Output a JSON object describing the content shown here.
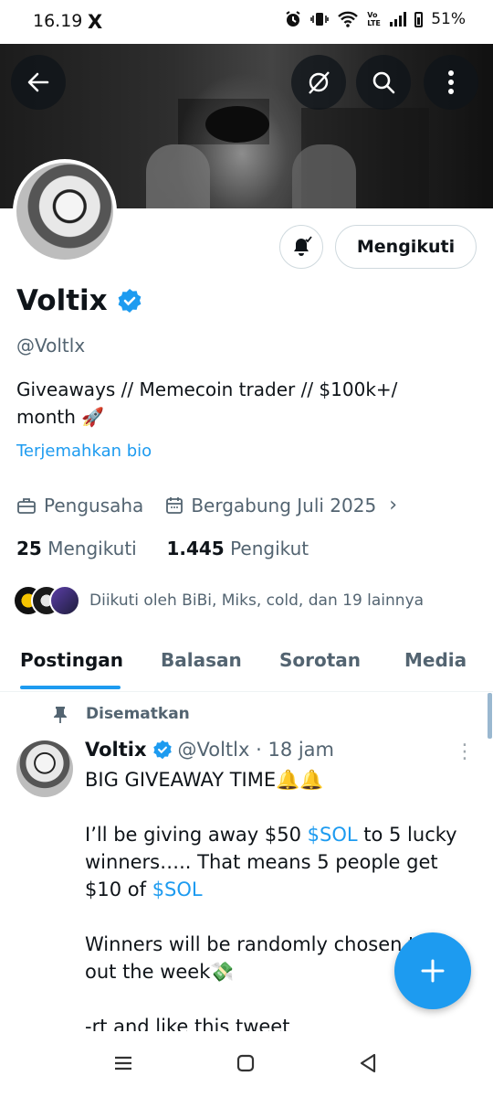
{
  "status": {
    "time": "16.19",
    "x_logo": "X",
    "volte": "Vo LTE",
    "battery": "51%"
  },
  "profile": {
    "name": "Voltix",
    "handle": "@Voltlx",
    "bio_line1": "Giveaways // Memecoin trader // $100k+/",
    "bio_line2": "month 🚀",
    "translate_label": "Terjemahkan bio",
    "category": "Pengusaha",
    "joined": "Bergabung Juli 2025",
    "following_count": "25",
    "following_label": "Mengikuti",
    "followers_count": "1.445",
    "followers_label": "Pengikut",
    "followed_by": "Diikuti oleh BiBi, Miks, cold, dan 19 lainnya",
    "follow_button": "Mengikuti"
  },
  "tabs": [
    {
      "label": "Postingan",
      "active": true
    },
    {
      "label": "Balasan",
      "active": false
    },
    {
      "label": "Sorotan",
      "active": false
    },
    {
      "label": "Media",
      "active": false
    }
  ],
  "post": {
    "pinned_label": "Disematkan",
    "author_name": "Voltix",
    "author_meta": "@Voltlx · 18 jam",
    "line1": "BIG GIVEAWAY TIME🔔🔔",
    "para2_a": "I’ll be giving away $50 ",
    "para2_tag1": "$SOL",
    "para2_b": " to 5 lucky winners….. That means 5 people get $10 of ",
    "para2_tag2": "$SOL",
    "para3": "Winners will be randomly chosen th    h out the week💸",
    "para4": "-rt and like this tweet"
  },
  "icons": {
    "back": "arrow-left-icon",
    "grok": "grok-icon",
    "search": "search-icon",
    "more": "more-vertical-icon",
    "bell": "bell-icon",
    "verified": "verified-badge-icon",
    "briefcase": "briefcase-icon",
    "calendar": "calendar-icon",
    "pin": "pin-icon",
    "compose": "plus-icon"
  },
  "colors": {
    "accent": "#1d9bf0",
    "text": "#0f1419",
    "secondary": "#536471"
  }
}
